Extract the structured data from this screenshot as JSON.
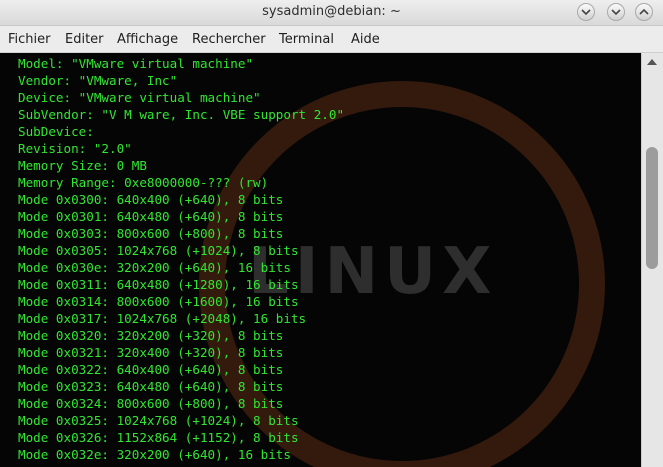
{
  "window": {
    "title": "sysadmin@debian: ~"
  },
  "menubar": {
    "items": [
      "Fichier",
      "Editer",
      "Affichage",
      "Rechercher",
      "Terminal",
      "Aide"
    ]
  },
  "terminal": {
    "background_logo_text": "LINUX",
    "lines": [
      "Model: \"VMware virtual machine\"",
      "Vendor: \"VMware, Inc\"",
      "Device: \"VMware virtual machine\"",
      "SubVendor: \"V M ware, Inc. VBE support 2.0\"",
      "SubDevice:",
      "Revision: \"2.0\"",
      "Memory Size: 0 MB",
      "Memory Range: 0xe8000000-??? (rw)",
      "Mode 0x0300: 640x400 (+640), 8 bits",
      "Mode 0x0301: 640x480 (+640), 8 bits",
      "Mode 0x0303: 800x600 (+800), 8 bits",
      "Mode 0x0305: 1024x768 (+1024), 8 bits",
      "Mode 0x030e: 320x200 (+640), 16 bits",
      "Mode 0x0311: 640x480 (+1280), 16 bits",
      "Mode 0x0314: 800x600 (+1600), 16 bits",
      "Mode 0x0317: 1024x768 (+2048), 16 bits",
      "Mode 0x0320: 320x200 (+320), 8 bits",
      "Mode 0x0321: 320x400 (+320), 8 bits",
      "Mode 0x0322: 640x400 (+640), 8 bits",
      "Mode 0x0323: 640x480 (+640), 8 bits",
      "Mode 0x0324: 800x600 (+800), 8 bits",
      "Mode 0x0325: 1024x768 (+1024), 8 bits",
      "Mode 0x0326: 1152x864 (+1152), 8 bits",
      "Mode 0x032e: 320x200 (+640), 16 bits"
    ]
  },
  "colors": {
    "terminal_text": "#31e631",
    "terminal_background": "#050505",
    "logo_color": "#3a1c0e"
  }
}
